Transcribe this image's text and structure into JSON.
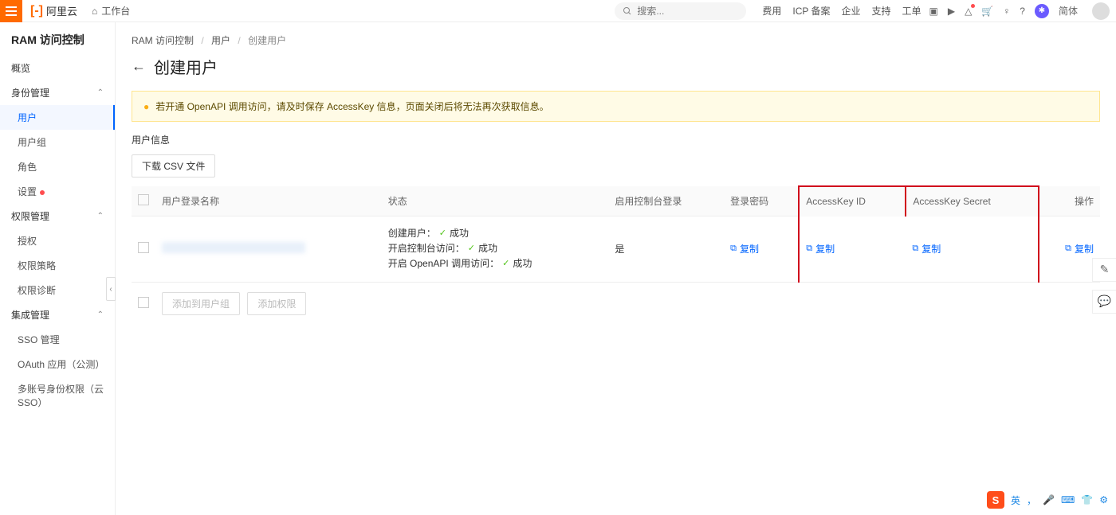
{
  "topbar": {
    "brand": "阿里云",
    "workspace_label": "工作台",
    "search_placeholder": "搜索...",
    "links": [
      "费用",
      "ICP 备案",
      "企业",
      "支持",
      "工单"
    ],
    "lang": "简体"
  },
  "sidebar": {
    "title": "RAM 访问控制",
    "items": [
      {
        "label": "概览",
        "type": "item"
      },
      {
        "label": "身份管理",
        "type": "group"
      },
      {
        "label": "用户",
        "type": "sub",
        "active": true
      },
      {
        "label": "用户组",
        "type": "sub"
      },
      {
        "label": "角色",
        "type": "sub"
      },
      {
        "label": "设置",
        "type": "sub",
        "dot": true
      },
      {
        "label": "权限管理",
        "type": "group"
      },
      {
        "label": "授权",
        "type": "sub"
      },
      {
        "label": "权限策略",
        "type": "sub"
      },
      {
        "label": "权限诊断",
        "type": "sub"
      },
      {
        "label": "集成管理",
        "type": "group"
      },
      {
        "label": "SSO 管理",
        "type": "sub"
      },
      {
        "label": "OAuth 应用（公测）",
        "type": "sub"
      },
      {
        "label": "多账号身份权限（云 SSO）",
        "type": "sub"
      }
    ]
  },
  "breadcrumb": {
    "a": "RAM 访问控制",
    "b": "用户",
    "c": "创建用户"
  },
  "page": {
    "title": "创建用户",
    "warning": "若开通 OpenAPI 调用访问，请及时保存 AccessKey 信息，页面关闭后将无法再次获取信息。",
    "section": "用户信息",
    "download_btn": "下载 CSV 文件"
  },
  "table": {
    "headers": {
      "login_name": "用户登录名称",
      "status": "状态",
      "console": "启用控制台登录",
      "password": "登录密码",
      "ak_id": "AccessKey ID",
      "ak_secret": "AccessKey Secret",
      "action": "操作"
    },
    "row": {
      "status1_a": "创建用户：",
      "status1_b": "成功",
      "status2_a": "开启控制台访问：",
      "status2_b": "成功",
      "status3_a": "开启 OpenAPI 调用访问：",
      "status3_b": "成功",
      "console": "是",
      "copy": "复制"
    },
    "actions": {
      "add_group": "添加到用户组",
      "add_perm": "添加权限"
    }
  },
  "ime": {
    "badge": "S",
    "lang": "英"
  }
}
